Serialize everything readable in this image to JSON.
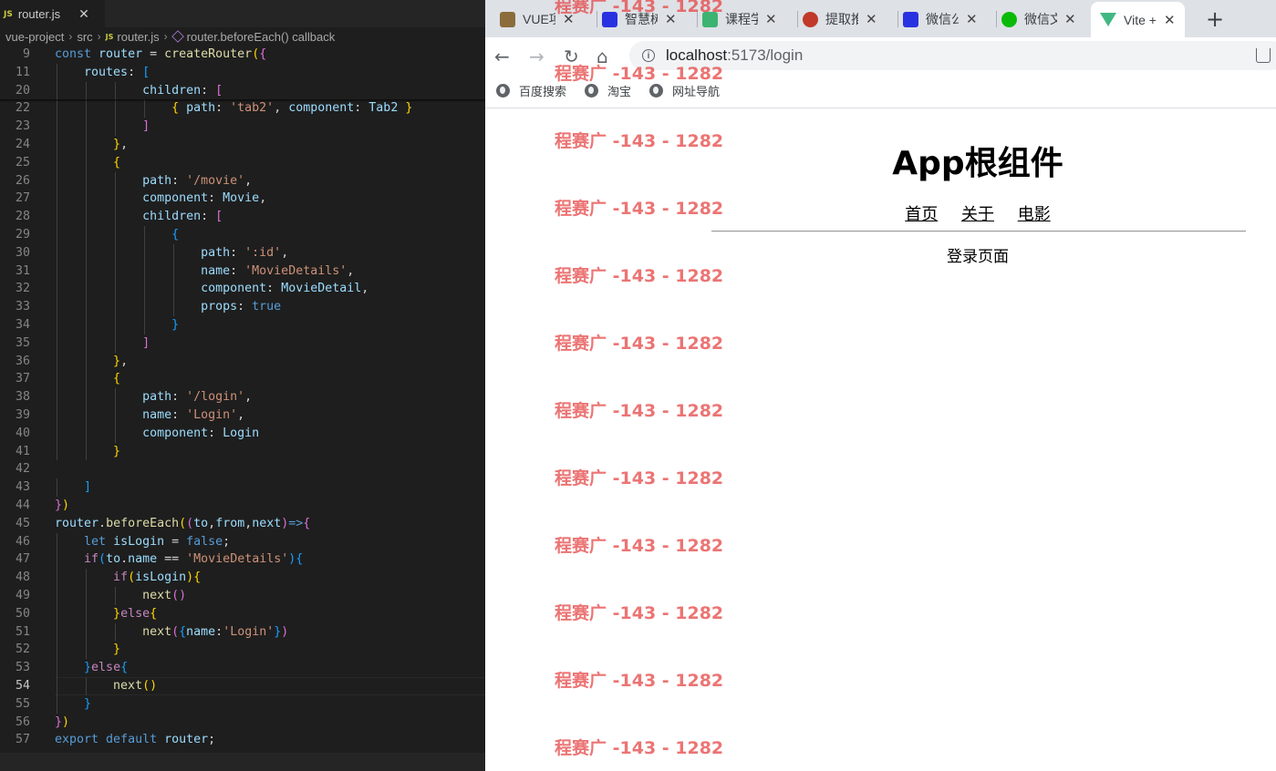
{
  "editor": {
    "tab": {
      "badge": "JS",
      "filename": "router.js",
      "close": "✕"
    },
    "breadcrumb": [
      "vue-project",
      "src",
      "router.js",
      "router.beforeEach() callback"
    ],
    "breadcrumb_badge": "JS",
    "current_line": 54
  },
  "code_lines": [
    {
      "n": 9,
      "tokens": [
        [
          "k",
          "const "
        ],
        [
          "v",
          "router"
        ],
        [
          "p",
          " = "
        ],
        [
          "f",
          "createRouter"
        ],
        [
          "b1",
          "("
        ],
        [
          "b2",
          "{"
        ]
      ]
    },
    {
      "n": 11,
      "tokens": [
        [
          "p",
          "    "
        ],
        [
          "v",
          "routes"
        ],
        [
          "p",
          ": "
        ],
        [
          "b3",
          "["
        ]
      ]
    },
    {
      "n": 20,
      "tokens": [
        [
          "p",
          "            "
        ],
        [
          "v",
          "children"
        ],
        [
          "p",
          ": "
        ],
        [
          "b2",
          "["
        ]
      ]
    },
    {
      "n": 22,
      "tokens": [
        [
          "p",
          "                "
        ],
        [
          "b1",
          "{ "
        ],
        [
          "v",
          "path"
        ],
        [
          "p",
          ": "
        ],
        [
          "s",
          "'tab2'"
        ],
        [
          "p",
          ", "
        ],
        [
          "v",
          "component"
        ],
        [
          "p",
          ": "
        ],
        [
          "v",
          "Tab2"
        ],
        [
          "b1",
          " }"
        ]
      ]
    },
    {
      "n": 23,
      "tokens": [
        [
          "p",
          "            "
        ],
        [
          "b2",
          "]"
        ]
      ]
    },
    {
      "n": 24,
      "tokens": [
        [
          "p",
          "        "
        ],
        [
          "b1",
          "}"
        ],
        [
          "p",
          ","
        ]
      ]
    },
    {
      "n": 25,
      "tokens": [
        [
          "p",
          "        "
        ],
        [
          "b1",
          "{"
        ]
      ]
    },
    {
      "n": 26,
      "tokens": [
        [
          "p",
          "            "
        ],
        [
          "v",
          "path"
        ],
        [
          "p",
          ": "
        ],
        [
          "s",
          "'/movie'"
        ],
        [
          "p",
          ","
        ]
      ]
    },
    {
      "n": 27,
      "tokens": [
        [
          "p",
          "            "
        ],
        [
          "v",
          "component"
        ],
        [
          "p",
          ": "
        ],
        [
          "v",
          "Movie"
        ],
        [
          "p",
          ","
        ]
      ]
    },
    {
      "n": 28,
      "tokens": [
        [
          "p",
          "            "
        ],
        [
          "v",
          "children"
        ],
        [
          "p",
          ": "
        ],
        [
          "b2",
          "["
        ]
      ]
    },
    {
      "n": 29,
      "tokens": [
        [
          "p",
          "                "
        ],
        [
          "b3",
          "{"
        ]
      ]
    },
    {
      "n": 30,
      "tokens": [
        [
          "p",
          "                    "
        ],
        [
          "v",
          "path"
        ],
        [
          "p",
          ": "
        ],
        [
          "s",
          "':id'"
        ],
        [
          "p",
          ","
        ]
      ]
    },
    {
      "n": 31,
      "tokens": [
        [
          "p",
          "                    "
        ],
        [
          "v",
          "name"
        ],
        [
          "p",
          ": "
        ],
        [
          "s",
          "'MovieDetails'"
        ],
        [
          "p",
          ","
        ]
      ]
    },
    {
      "n": 32,
      "tokens": [
        [
          "p",
          "                    "
        ],
        [
          "v",
          "component"
        ],
        [
          "p",
          ": "
        ],
        [
          "v",
          "MovieDetail"
        ],
        [
          "p",
          ","
        ]
      ]
    },
    {
      "n": 33,
      "tokens": [
        [
          "p",
          "                    "
        ],
        [
          "v",
          "props"
        ],
        [
          "p",
          ": "
        ],
        [
          "k",
          "true"
        ]
      ]
    },
    {
      "n": 34,
      "tokens": [
        [
          "p",
          "                "
        ],
        [
          "b3",
          "}"
        ]
      ]
    },
    {
      "n": 35,
      "tokens": [
        [
          "p",
          "            "
        ],
        [
          "b2",
          "]"
        ]
      ]
    },
    {
      "n": 36,
      "tokens": [
        [
          "p",
          "        "
        ],
        [
          "b1",
          "}"
        ],
        [
          "p",
          ","
        ]
      ]
    },
    {
      "n": 37,
      "tokens": [
        [
          "p",
          "        "
        ],
        [
          "b1",
          "{"
        ]
      ]
    },
    {
      "n": 38,
      "tokens": [
        [
          "p",
          "            "
        ],
        [
          "v",
          "path"
        ],
        [
          "p",
          ": "
        ],
        [
          "s",
          "'/login'"
        ],
        [
          "p",
          ","
        ]
      ]
    },
    {
      "n": 39,
      "tokens": [
        [
          "p",
          "            "
        ],
        [
          "v",
          "name"
        ],
        [
          "p",
          ": "
        ],
        [
          "s",
          "'Login'"
        ],
        [
          "p",
          ","
        ]
      ]
    },
    {
      "n": 40,
      "tokens": [
        [
          "p",
          "            "
        ],
        [
          "v",
          "component"
        ],
        [
          "p",
          ": "
        ],
        [
          "v",
          "Login"
        ]
      ]
    },
    {
      "n": 41,
      "tokens": [
        [
          "p",
          "        "
        ],
        [
          "b1",
          "}"
        ]
      ]
    },
    {
      "n": 42,
      "tokens": []
    },
    {
      "n": 43,
      "tokens": [
        [
          "p",
          "    "
        ],
        [
          "b3",
          "]"
        ]
      ]
    },
    {
      "n": 44,
      "tokens": [
        [
          "b2",
          "}"
        ],
        [
          "b1",
          ")"
        ]
      ]
    },
    {
      "n": 45,
      "tokens": [
        [
          "v",
          "router"
        ],
        [
          "p",
          "."
        ],
        [
          "f",
          "beforeEach"
        ],
        [
          "b1",
          "("
        ],
        [
          "b2",
          "("
        ],
        [
          "v",
          "to"
        ],
        [
          "p",
          ","
        ],
        [
          "v",
          "from"
        ],
        [
          "p",
          ","
        ],
        [
          "v",
          "next"
        ],
        [
          "b2",
          ")"
        ],
        [
          "k",
          "=>"
        ],
        [
          "b2",
          "{"
        ]
      ]
    },
    {
      "n": 46,
      "tokens": [
        [
          "p",
          "    "
        ],
        [
          "k",
          "let "
        ],
        [
          "v",
          "isLogin"
        ],
        [
          "p",
          " = "
        ],
        [
          "k",
          "false"
        ],
        [
          "p",
          ";"
        ]
      ]
    },
    {
      "n": 47,
      "tokens": [
        [
          "p",
          "    "
        ],
        [
          "c",
          "if"
        ],
        [
          "b3",
          "("
        ],
        [
          "v",
          "to"
        ],
        [
          "p",
          "."
        ],
        [
          "v",
          "name"
        ],
        [
          "p",
          " == "
        ],
        [
          "s",
          "'MovieDetails'"
        ],
        [
          "b3",
          ")"
        ],
        [
          "b3",
          "{"
        ]
      ]
    },
    {
      "n": 48,
      "tokens": [
        [
          "p",
          "        "
        ],
        [
          "c",
          "if"
        ],
        [
          "b1",
          "("
        ],
        [
          "v",
          "isLogin"
        ],
        [
          "b1",
          ")"
        ],
        [
          "b1",
          "{"
        ]
      ]
    },
    {
      "n": 49,
      "tokens": [
        [
          "p",
          "            "
        ],
        [
          "f",
          "next"
        ],
        [
          "b2",
          "()"
        ]
      ]
    },
    {
      "n": 50,
      "tokens": [
        [
          "p",
          "        "
        ],
        [
          "b1",
          "}"
        ],
        [
          "c",
          "else"
        ],
        [
          "b1",
          "{"
        ]
      ]
    },
    {
      "n": 51,
      "tokens": [
        [
          "p",
          "            "
        ],
        [
          "f",
          "next"
        ],
        [
          "b2",
          "("
        ],
        [
          "b3",
          "{"
        ],
        [
          "v",
          "name"
        ],
        [
          "p",
          ":"
        ],
        [
          "s",
          "'Login'"
        ],
        [
          "b3",
          "}"
        ],
        [
          "b2",
          ")"
        ]
      ]
    },
    {
      "n": 52,
      "tokens": [
        [
          "p",
          "        "
        ],
        [
          "b1",
          "}"
        ]
      ]
    },
    {
      "n": 53,
      "tokens": [
        [
          "p",
          "    "
        ],
        [
          "b3",
          "}"
        ],
        [
          "c",
          "else"
        ],
        [
          "b3",
          "{"
        ]
      ]
    },
    {
      "n": 54,
      "tokens": [
        [
          "p",
          "        "
        ],
        [
          "f",
          "next"
        ],
        [
          "b1",
          "()"
        ]
      ]
    },
    {
      "n": 55,
      "tokens": [
        [
          "p",
          "    "
        ],
        [
          "b3",
          "}"
        ]
      ]
    },
    {
      "n": 56,
      "tokens": [
        [
          "b2",
          "}"
        ],
        [
          "b1",
          ")"
        ]
      ]
    },
    {
      "n": 57,
      "tokens": [
        [
          "k",
          "export "
        ],
        [
          "k",
          "default "
        ],
        [
          "v",
          "router"
        ],
        [
          "p",
          ";"
        ]
      ]
    }
  ],
  "browser": {
    "tabs": [
      {
        "title": "VUE项",
        "icon": "image-favicon",
        "color": "#8a6d3b"
      },
      {
        "title": "智慧树",
        "icon": "baidu-paw-icon",
        "color": "#2932e1"
      },
      {
        "title": "课程学",
        "icon": "audio-bars-icon",
        "color": "#3cb371"
      },
      {
        "title": "提取推",
        "icon": "avatar-favicon",
        "color": "#c0392b"
      },
      {
        "title": "微信公",
        "icon": "baidu-paw-icon",
        "color": "#2932e1"
      },
      {
        "title": "微信文",
        "icon": "wechat-icon",
        "color": "#09bb07"
      },
      {
        "title": "Vite + Vue",
        "icon": "vue-logo-icon",
        "color": "#41b883"
      }
    ],
    "close_glyph": "✕",
    "new_tab": "+",
    "url_host": "localhost",
    "url_path": ":5173/login",
    "bookmarks": [
      "百度搜索",
      "淘宝",
      "网址导航"
    ]
  },
  "page": {
    "title": "App根组件",
    "nav": [
      "首页",
      "关于",
      "电影"
    ],
    "content": "登录页面"
  },
  "watermark": {
    "text": "程赛广 -143 - 1282",
    "color": "#e64646"
  }
}
